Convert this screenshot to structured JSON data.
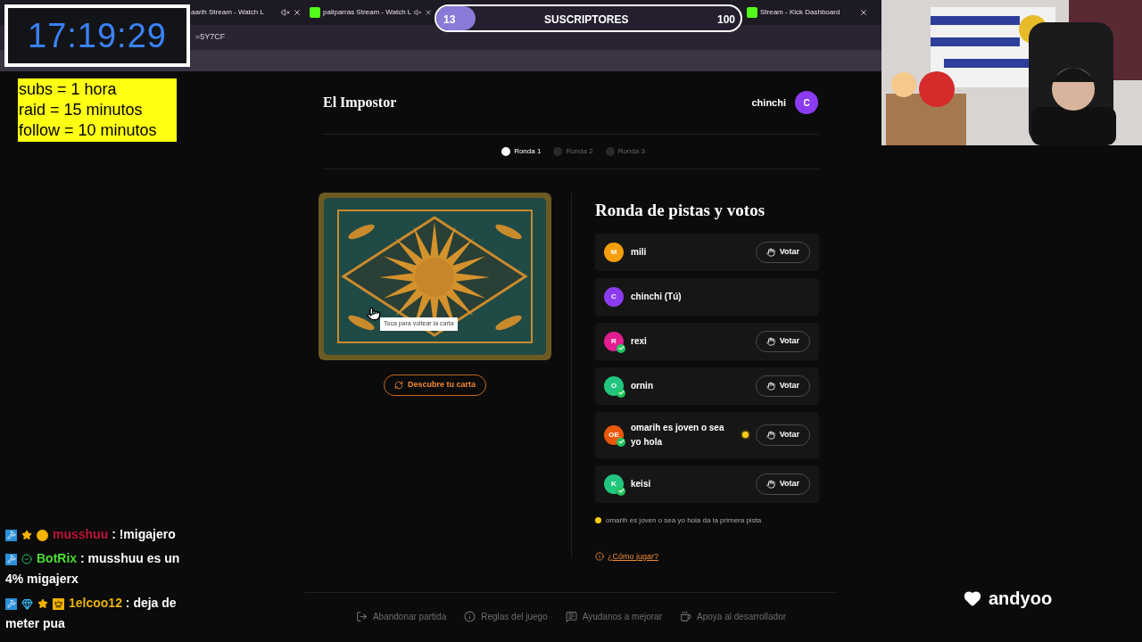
{
  "timer": {
    "time": "17:19:29"
  },
  "goals_note": {
    "lines": [
      "subs = 1 hora",
      "raid = 15 minutos",
      "follow = 10 minutos"
    ]
  },
  "browser": {
    "tabs": [
      {
        "title": "aarih Stream - Watch L",
        "kind": "plain"
      },
      {
        "title": "paliparras Stream - Watch L",
        "kind": "kick"
      },
      {
        "title": "Stream - Kick Dashboard",
        "kind": "kick"
      }
    ],
    "address": "=5Y7CF"
  },
  "sub_goal": {
    "current": "13",
    "label": "SUSCRIPTORES",
    "target": "100",
    "level": 0.13
  },
  "game": {
    "title": "El Impostor",
    "user": {
      "name": "chinchi",
      "initial": "C",
      "color": "#8b3cf0"
    },
    "rounds": [
      {
        "label": "Ronda 1",
        "selected": true
      },
      {
        "label": "Ronda 2",
        "selected": false
      },
      {
        "label": "Ronda 3",
        "selected": false
      }
    ],
    "card_tooltip": "Toca para voltear la carta",
    "reveal_button": "Descubre tu carta",
    "heading": "Ronda de pistas y votos",
    "players": [
      {
        "initials": "M",
        "name": "mili",
        "color": "#f59e0b",
        "done": false,
        "first_hint": false,
        "vote": "Votar"
      },
      {
        "initials": "C",
        "name": "chinchi (Tú)",
        "color": "#8b3cf0",
        "done": false,
        "first_hint": false
      },
      {
        "initials": "R",
        "name": "rexi",
        "color": "#e11d8f",
        "done": true,
        "first_hint": false,
        "vote": "Votar"
      },
      {
        "initials": "O",
        "name": "ornin",
        "color": "#22c57e",
        "done": true,
        "first_hint": false,
        "vote": "Votar"
      },
      {
        "initials": "OE",
        "name": "omarih es joven o sea yo hola",
        "color": "#ea580c",
        "done": true,
        "first_hint": true,
        "vote": "Votar"
      },
      {
        "initials": "K",
        "name": "keisi",
        "color": "#22c57e",
        "done": true,
        "first_hint": false,
        "vote": "Votar"
      }
    ],
    "first_hint_note": "omarih es joven o sea yo hola da la primera pista",
    "help_link": "¿Cómo jugar?",
    "footer": [
      {
        "kind": "leave",
        "label": "Abandonar partida"
      },
      {
        "kind": "rules",
        "label": "Reglas del juego"
      },
      {
        "kind": "feedback",
        "label": "Ayudanos a mejorar"
      },
      {
        "kind": "support",
        "label": "Apoya al desarrollador"
      }
    ]
  },
  "chat": [
    {
      "user": "musshuu",
      "color": "#c0143c",
      "separator": ":",
      "text": "!migajero",
      "badges": [
        {
          "kind": "mod"
        },
        {
          "kind": "star"
        },
        {
          "kind": "coin"
        }
      ]
    },
    {
      "user": "BotRix",
      "color": "#4ade30",
      "separator": ":",
      "text": "musshuu es un 4% migajerx",
      "badges": [
        {
          "kind": "mod"
        },
        {
          "kind": "verified"
        }
      ]
    },
    {
      "user": "1elcoo12",
      "color": "#eab308",
      "separator": ":",
      "text": "deja de meter pua",
      "badges": [
        {
          "kind": "mod"
        },
        {
          "kind": "gem"
        },
        {
          "kind": "star"
        },
        {
          "kind": "crown"
        }
      ]
    }
  ],
  "streamer": {
    "name": "andyoo"
  }
}
